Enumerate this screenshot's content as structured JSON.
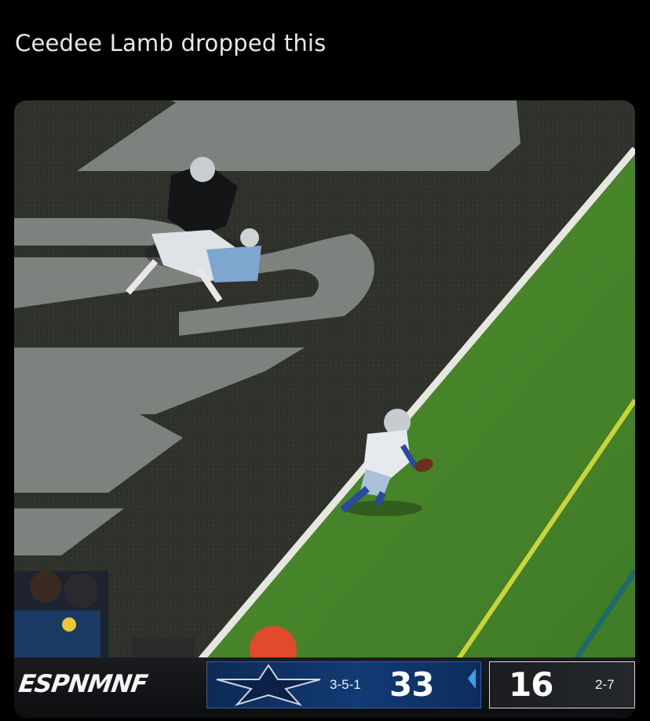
{
  "post": {
    "caption": "Ceedee Lamb dropped this"
  },
  "scorebug": {
    "network": "ESPN",
    "show": "MNF",
    "home": {
      "logo": "star-icon",
      "record": "3-5-1",
      "score": "33",
      "color": "#123a74"
    },
    "away": {
      "score": "16",
      "record": "2-7",
      "color": "#1b1d20"
    },
    "possession_color": "#3aa0e8"
  },
  "colors": {
    "background": "#000000",
    "caption_text": "#e7e9ea",
    "turf": "#4c8a2c",
    "endzone": "#2f332c",
    "first_down_line": "#c8d43a"
  }
}
